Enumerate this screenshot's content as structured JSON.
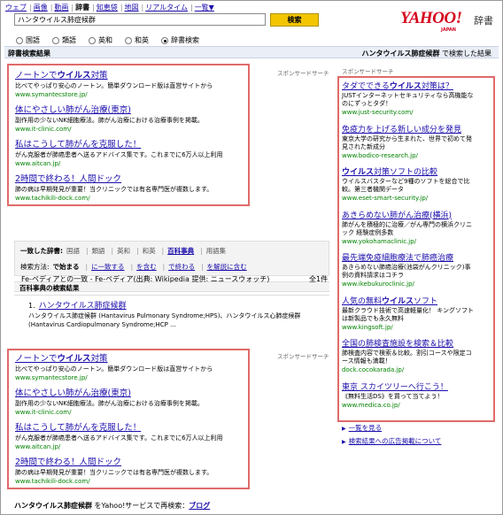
{
  "nav": {
    "items": [
      "ウェブ",
      "画像",
      "動画",
      "辞書",
      "知恵袋",
      "地図",
      "リアルタイム",
      "一覧▼"
    ],
    "current_index": 3
  },
  "search": {
    "query": "ハンタウイルス肺症候群",
    "button": "検索"
  },
  "logo": {
    "brand": "YAHOO!",
    "sub": "JAPAN",
    "service": "辞書"
  },
  "radios": [
    {
      "label": "国語",
      "selected": false
    },
    {
      "label": "類語",
      "selected": false
    },
    {
      "label": "英和",
      "selected": false
    },
    {
      "label": "和英",
      "selected": false
    },
    {
      "label": "辞書検索",
      "selected": true
    }
  ],
  "header_bar": {
    "left": "辞書検索結果",
    "right_query": "ハンタウイルス肺症候群",
    "right_suffix": " で検索した結果"
  },
  "sponsored_label": "スポンサードサーチ",
  "top_ads": [
    {
      "title_pre": "ノートンで",
      "title_bold": "ウイルス",
      "title_post": "対策",
      "desc": "比べてやっぱり安心のノートン。簡単ダウンロード版は直営サイトから",
      "url": "www.symantecstore.jp/"
    },
    {
      "title_pre": "体にやさしい肺がん治療(東京)",
      "title_bold": "",
      "title_post": "",
      "desc": "副作用の少ないNK細胞療法。肺がん治療における治療事例を掲載。",
      "url": "www.it-clinic.com/"
    },
    {
      "title_pre": "私はこうして肺がんを克服した！",
      "title_bold": "",
      "title_post": "",
      "desc": "がん克服者が肺癌患者へ送るアドバイス集です。これまでに6万人以上利用",
      "url": "www.aitcan.jp/"
    },
    {
      "title_pre": "2時間で終わる！人間ドック",
      "title_bold": "",
      "title_post": "",
      "desc": "肺の病は早期発見が重要！当クリニックでは有名専門医が複数します。",
      "url": "www.tachikili-dock.com/"
    }
  ],
  "right_ads": [
    {
      "title_pre": "タダでできる",
      "title_bold": "ウイルス",
      "title_post": "対策は？",
      "desc": "JUSTインターネットセキュリティなら高機能なのにずっとタダ！",
      "url": "www.just-security.com/"
    },
    {
      "title_pre": "免疫力を上げる新しい成分を発見",
      "title_bold": "",
      "title_post": "",
      "desc": "東京大学の研究から生まれた、世界で初めて発見された新成分",
      "url": "www.bodico-research.jp/"
    },
    {
      "title_pre": "",
      "title_bold": "ウイルス",
      "title_post": "対策ソフトの比較",
      "desc": "ウイルスバスターなど9種のソフトを総合で比較。第三者機関データ",
      "url": "www.eset-smart-security.jp/"
    },
    {
      "title_pre": "あきらめない肺がん治療(横浜)",
      "title_bold": "",
      "title_post": "",
      "desc": "肺がんを積極的に治療／がん専門の横浜クリニック 経験症例多数",
      "url": "www.yokohamaclinic.jp/"
    },
    {
      "title_pre": "最先端免疫細胞療法で肺癌治療",
      "title_bold": "",
      "title_post": "",
      "desc": "あきらめない肺癌治療(池袋がんクリニック)事例の資料請求はコチラ",
      "url": "www.ikebukuroclinic.jp/"
    },
    {
      "title_pre": "人気の無料",
      "title_bold": "ウイルス",
      "title_post": "ソフト",
      "desc": "最新クラウド技術で高速軽量化！ キングソフトは新製品でも永久無料",
      "url": "www.kingsoft.jp/"
    },
    {
      "title_pre": "全国の肺検査施設を検索＆比較",
      "title_bold": "",
      "title_post": "",
      "desc": "肺検査内容で検索＆比較。割引コースや限定コース情報も満載！",
      "url": "dock.cocokarada.jp/"
    },
    {
      "title_pre": "東京 スカイツリーへ行こう！",
      "title_bold": "",
      "title_post": "",
      "desc": "《無料生活DS》を買って当てよう！",
      "url": "www.medica.co.jp/"
    }
  ],
  "right_links": [
    "一覧を見る",
    "検索結果への広告掲載について"
  ],
  "panel": {
    "dict_label": "一致した辞書:",
    "dicts": [
      "国語",
      "類語",
      "英和",
      "和英",
      "百科事典",
      "用語集"
    ],
    "dict_active": "百科事典",
    "method_label": "検索方法:",
    "methods": [
      "で始まる",
      "に一致する",
      "を含む",
      "で終わる",
      "を解説に含む"
    ],
    "method_active": "で始まる"
  },
  "section_title": "百科事典の検索結果",
  "source_line": "Fe-ペディアとの一致 - Fe-ペディア(出典: Wikipedia 提供: ニュースウォッチ)",
  "count": "全1件",
  "result": {
    "number": "1.",
    "title": "ハンタウイルス肺症候群",
    "desc": "ハンタウイルス肺症候群 (Hantavirus Pulmonary Syndrome;HPS)、ハンタウイルス心肺症候群 (Hantavirus Cardiopulmonary Syndrome;HCP ..."
  },
  "footer": {
    "query": "ハンタウイルス肺症候群",
    "text": " をYahoo!サービスで再検索：",
    "link": "ブログ"
  }
}
